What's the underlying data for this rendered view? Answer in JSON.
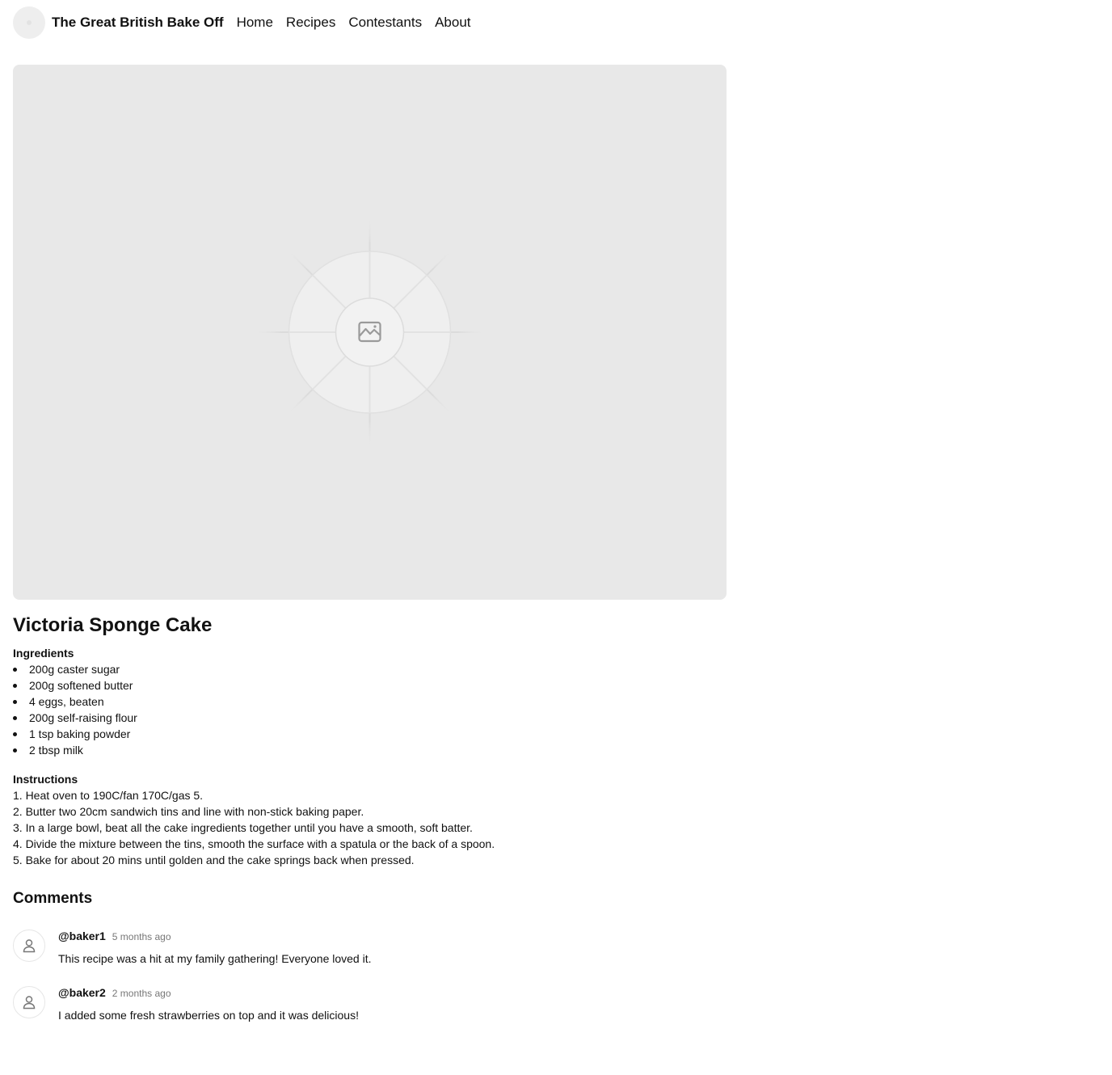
{
  "header": {
    "site_title": "The Great British Bake Off",
    "nav": [
      "Home",
      "Recipes",
      "Contestants",
      "About"
    ]
  },
  "hero": {
    "icon": "image-placeholder-icon"
  },
  "recipe": {
    "title": "Victoria Sponge Cake",
    "ingredients_heading": "Ingredients",
    "ingredients": [
      "200g caster sugar",
      "200g softened butter",
      "4 eggs, beaten",
      "200g self-raising flour",
      "1 tsp baking powder",
      "2 tbsp milk"
    ],
    "instructions_heading": "Instructions",
    "instructions": [
      "1. Heat oven to 190C/fan 170C/gas 5.",
      "2. Butter two 20cm sandwich tins and line with non-stick baking paper.",
      "3. In a large bowl, beat all the cake ingredients together until you have a smooth, soft batter.",
      "4. Divide the mixture between the tins, smooth the surface with a spatula or the back of a spoon.",
      "5. Bake for about 20 mins until golden and the cake springs back when pressed."
    ]
  },
  "comments": {
    "heading": "Comments",
    "items": [
      {
        "user": "@baker1",
        "time": "5 months ago",
        "text": "This recipe was a hit at my family gathering! Everyone loved it.",
        "avatar_icon": "user-icon"
      },
      {
        "user": "@baker2",
        "time": "2 months ago",
        "text": "I added some fresh strawberries on top and it was delicious!",
        "avatar_icon": "user-icon"
      }
    ]
  },
  "colors": {
    "placeholder_bg": "#e8e8e8",
    "text": "#111111",
    "muted": "#777777"
  }
}
